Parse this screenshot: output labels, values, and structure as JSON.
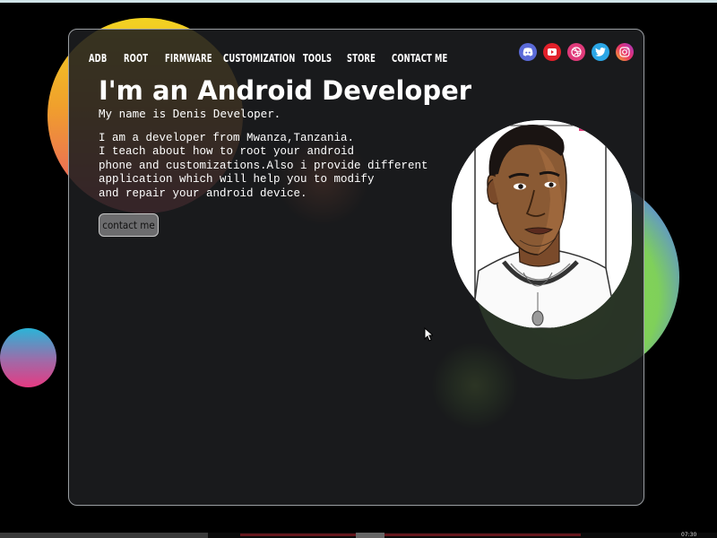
{
  "nav": [
    "ADB",
    "ROOT",
    "FIRMWARE",
    "CUSTOMIZATION",
    "TOOLS",
    "STORE",
    "CONTACT ME"
  ],
  "social_icons": [
    "discord-icon",
    "youtube-icon",
    "dribbble-icon",
    "twitter-icon",
    "instagram-icon"
  ],
  "hero": {
    "title": "I'm an Android Developer",
    "name_line": "My name is Denis Developer.",
    "bio_lines": [
      "I am a developer from Mwanza,Tanzania.",
      "I teach about how to root your android",
      "phone and customizations.Also i provide different",
      "application which will help you to modify",
      "and repair your android device."
    ],
    "contact_button": "contact me"
  },
  "colors": {
    "background": "#000000",
    "card": "#1c1e20",
    "accent_yellow": "#f2d322",
    "accent_green": "#8ee04a",
    "accent_pink": "#e63a82"
  },
  "taskbar": {
    "clock": "07:30"
  }
}
